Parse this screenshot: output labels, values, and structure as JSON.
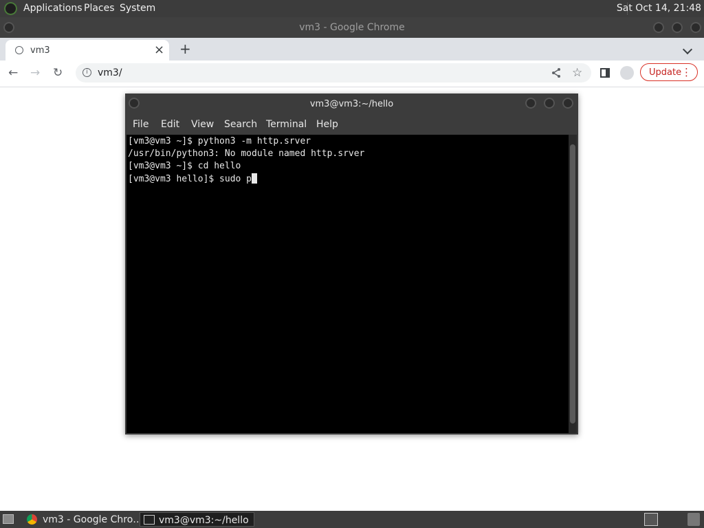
{
  "top_panel": {
    "menus": [
      "Applications",
      "Places",
      "System"
    ],
    "clock": "Sat Oct 14, 21:48",
    "app_icon": "gnome-foot-icon"
  },
  "chrome": {
    "window_title": "vm3 - Google Chrome",
    "tab": {
      "label": "vm3",
      "close": "×",
      "new_tab": "+"
    },
    "toolbar": {
      "url": "vm3/",
      "update_label": "Update",
      "update_menu": "⋮",
      "back": "←",
      "forward": "→",
      "reload": "↻"
    },
    "colors": {
      "update_border": "#d93025",
      "tab_strip": "#dee1e6"
    }
  },
  "terminal": {
    "title": "vm3@vm3:~/hello",
    "menus": [
      "File",
      "Edit",
      "View",
      "Search",
      "Terminal",
      "Help"
    ],
    "lines": [
      "[vm3@vm3 ~]$ python3 -m http.srver",
      "/usr/bin/python3: No module named http.srver",
      "[vm3@vm3 ~]$ cd hello",
      "[vm3@vm3 hello]$ sudo p"
    ]
  },
  "taskbar": {
    "tasks": [
      {
        "label": "vm3 - Google Chro…",
        "icon": "chrome-icon"
      },
      {
        "label": "vm3@vm3:~/hello",
        "icon": "terminal-icon"
      }
    ]
  }
}
